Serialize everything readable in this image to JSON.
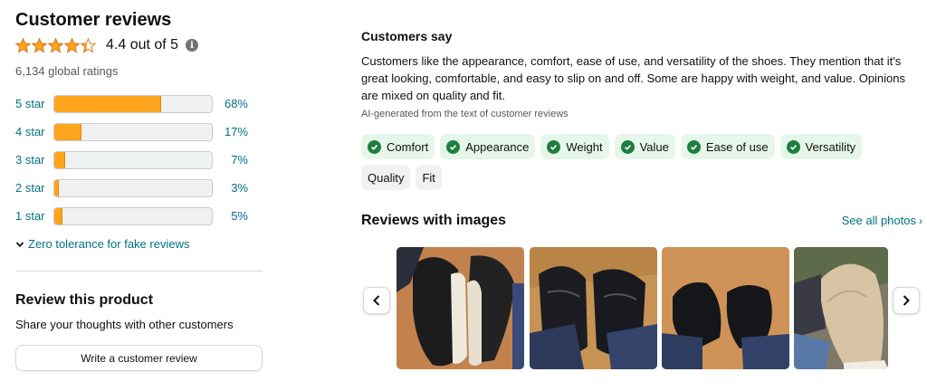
{
  "reviews": {
    "title": "Customer reviews",
    "rating_stars": 4.4,
    "rating_text": "4.4 out of 5",
    "global_ratings": "6,134 global ratings",
    "histogram": [
      {
        "label": "5 star",
        "percent": 68,
        "percent_text": "68%"
      },
      {
        "label": "4 star",
        "percent": 17,
        "percent_text": "17%"
      },
      {
        "label": "3 star",
        "percent": 7,
        "percent_text": "7%"
      },
      {
        "label": "2 star",
        "percent": 3,
        "percent_text": "3%"
      },
      {
        "label": "1 star",
        "percent": 5,
        "percent_text": "5%"
      }
    ],
    "fake_reviews_link": "Zero tolerance for fake reviews"
  },
  "review_product": {
    "heading": "Review this product",
    "subtext": "Share your thoughts with other customers",
    "button_label": "Write a customer review"
  },
  "customers_say": {
    "heading": "Customers say",
    "summary": "Customers like the appearance, comfort, ease of use, and versatility of the shoes. They mention that it's great looking, comfortable, and easy to slip on and off. Some are happy with weight, and value. Opinions are mixed on quality and fit.",
    "ai_note": "AI-generated from the text of customer reviews",
    "chips_positive": [
      "Comfort",
      "Appearance",
      "Weight",
      "Value",
      "Ease of use",
      "Versatility"
    ],
    "chips_neutral": [
      "Quality",
      "Fit"
    ]
  },
  "images_section": {
    "heading": "Reviews with images",
    "see_all": "See all photos"
  },
  "colors": {
    "star": "#ffa41c",
    "link": "#007185",
    "positive_chip": "#e6f7e9",
    "check": "#1d7e3f"
  },
  "icons": {
    "info": "info-icon",
    "chevron_down": "chevron-down-icon",
    "chevron_left": "chevron-left-icon",
    "chevron_right": "chevron-right-icon",
    "check": "check-circle-icon"
  }
}
